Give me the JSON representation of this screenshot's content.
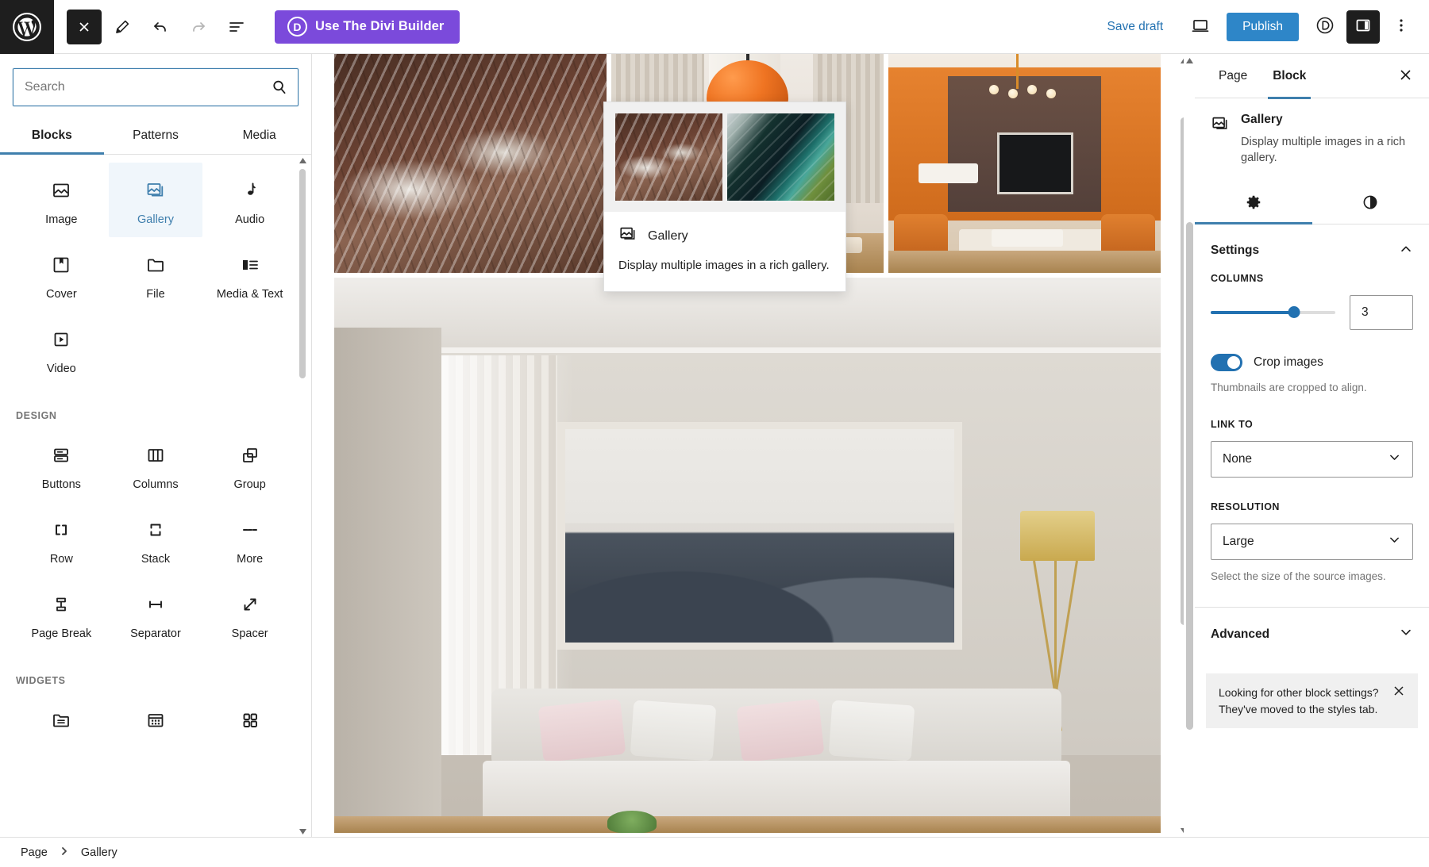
{
  "topbar": {
    "logo_icon": "wordpress-logo-icon",
    "close_icon": "close-x-icon",
    "edit_icon": "pencil-edit-icon",
    "undo_icon": "undo-arrow-icon",
    "redo_icon": "redo-arrow-icon",
    "list_view_icon": "document-overview-icon",
    "divi_label": "Use The Divi Builder",
    "divi_badge": "D",
    "save_draft_label": "Save draft",
    "preview_icon": "desktop-preview-icon",
    "publish_label": "Publish",
    "divi_toggle_icon": "divi-circle-icon",
    "sidebar_toggle_icon": "settings-sidebar-icon",
    "options_icon": "more-options-vertical-dots-icon",
    "accent_purple": "#7b4adb",
    "accent_blue": "#2e86c8",
    "link_blue": "#2271b1"
  },
  "inserter": {
    "search": {
      "placeholder": "Search",
      "value": "",
      "icon": "search-icon"
    },
    "tabs": [
      {
        "label": "Blocks",
        "active": true
      },
      {
        "label": "Patterns",
        "active": false
      },
      {
        "label": "Media",
        "active": false
      }
    ],
    "sections": [
      {
        "label": "",
        "blocks": [
          {
            "label": "Image",
            "icon": "image-icon",
            "selected": false
          },
          {
            "label": "Gallery",
            "icon": "gallery-icon",
            "selected": true
          },
          {
            "label": "Audio",
            "icon": "audio-note-icon",
            "selected": false
          },
          {
            "label": "Cover",
            "icon": "cover-icon",
            "selected": false
          },
          {
            "label": "File",
            "icon": "file-folder-icon",
            "selected": false
          },
          {
            "label": "Media & Text",
            "icon": "media-text-icon",
            "selected": false
          },
          {
            "label": "Video",
            "icon": "video-play-icon",
            "selected": false
          }
        ]
      },
      {
        "label": "DESIGN",
        "blocks": [
          {
            "label": "Buttons",
            "icon": "buttons-icon",
            "selected": false
          },
          {
            "label": "Columns",
            "icon": "columns-icon",
            "selected": false
          },
          {
            "label": "Group",
            "icon": "group-icon",
            "selected": false
          },
          {
            "label": "Row",
            "icon": "row-icon",
            "selected": false
          },
          {
            "label": "Stack",
            "icon": "stack-icon",
            "selected": false
          },
          {
            "label": "More",
            "icon": "more-dashes-icon",
            "selected": false
          },
          {
            "label": "Page Break",
            "icon": "page-break-icon",
            "selected": false
          },
          {
            "label": "Separator",
            "icon": "separator-icon",
            "selected": false
          },
          {
            "label": "Spacer",
            "icon": "spacer-arrows-icon",
            "selected": false
          }
        ]
      },
      {
        "label": "WIDGETS",
        "blocks": [
          {
            "label": "",
            "icon": "archives-folder-icon",
            "selected": false
          },
          {
            "label": "",
            "icon": "calendar-icon",
            "selected": false
          },
          {
            "label": "",
            "icon": "categories-grid-icon",
            "selected": false
          }
        ]
      }
    ]
  },
  "preview_popover": {
    "title": "Gallery",
    "description": "Display multiple images in a rich gallery.",
    "icon": "gallery-icon",
    "thumbs": [
      "satellite-glacier-thumb",
      "satellite-coast-thumb"
    ]
  },
  "canvas": {
    "gallery_images": [
      "satellite-glacier-image",
      "dining-room-orange-pendant-image",
      "living-room-orange-walls-image",
      "living-room-grey-sofa-painting-image"
    ],
    "scrollbar_up_icon": "scroll-up-arrow-icon",
    "scrollbar_down_icon": "scroll-down-arrow-icon"
  },
  "settings": {
    "tabs": [
      {
        "label": "Page",
        "active": false
      },
      {
        "label": "Block",
        "active": true
      }
    ],
    "close_icon": "close-x-icon",
    "block": {
      "icon": "gallery-icon",
      "name": "Gallery",
      "description": "Display multiple images in a rich gallery."
    },
    "mode_tabs": [
      {
        "icon": "gear-settings-icon",
        "active": true
      },
      {
        "icon": "styles-contrast-icon",
        "active": false
      }
    ],
    "settings_section": {
      "title": "Settings",
      "collapse_icon": "chevron-up-icon",
      "columns": {
        "label": "COLUMNS",
        "value": "3",
        "min": 1,
        "max": 5,
        "fill_percent": 67
      },
      "crop": {
        "label": "Crop images",
        "enabled": true,
        "help": "Thumbnails are cropped to align."
      },
      "link_to": {
        "label": "LINK TO",
        "value": "None",
        "chevron_icon": "chevron-down-icon"
      },
      "resolution": {
        "label": "RESOLUTION",
        "value": "Large",
        "chevron_icon": "chevron-down-icon",
        "help": "Select the size of the source images."
      }
    },
    "advanced_section": {
      "title": "Advanced",
      "expand_icon": "chevron-down-icon"
    },
    "notice": {
      "line1": "Looking for other block settings?",
      "line2": "They've moved to the styles tab.",
      "close_icon": "close-x-icon"
    },
    "accent_blue": "#2271b1"
  },
  "breadcrumb": {
    "items": [
      "Page",
      "Gallery"
    ],
    "separator": "›"
  }
}
